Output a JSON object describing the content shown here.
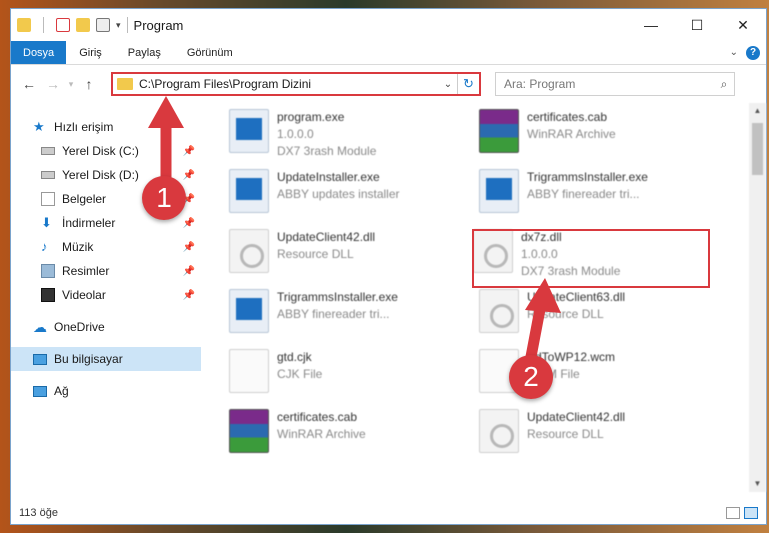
{
  "window": {
    "title": "Program"
  },
  "ribbon": {
    "tabs": [
      "Dosya",
      "Giriş",
      "Paylaş",
      "Görünüm"
    ],
    "help": "?"
  },
  "nav": {
    "back": "←",
    "forward": "→",
    "up": "↑",
    "address": "C:\\Program Files\\Program Dizini",
    "search_placeholder": "Ara: Program"
  },
  "sidebar": {
    "quick_access": "Hızlı erişim",
    "items": [
      {
        "label": "Yerel Disk (C:)"
      },
      {
        "label": "Yerel Disk (D:)"
      },
      {
        "label": "Belgeler"
      },
      {
        "label": "İndirmeler"
      },
      {
        "label": "Müzik"
      },
      {
        "label": "Resimler"
      },
      {
        "label": "Videolar"
      }
    ],
    "onedrive": "OneDrive",
    "this_pc": "Bu bilgisayar",
    "network": "Ağ"
  },
  "files": [
    {
      "name": "program.exe",
      "line1": "1.0.0.0",
      "line2": "DX7 3rash Module"
    },
    {
      "name": "certificates.cab",
      "line1": "WinRAR Archive",
      "line2": ""
    },
    {
      "name": "UpdateInstaller.exe",
      "line1": "ABBY updates installer",
      "line2": ""
    },
    {
      "name": "TrigrammsInstaller.exe",
      "line1": "ABBY finereader tri...",
      "line2": ""
    },
    {
      "name": "UpdateClient42.dll",
      "line1": "Resource DLL",
      "line2": ""
    },
    {
      "name": "dx7z.dll",
      "line1": "1.0.0.0",
      "line2": "DX7 3rash Module"
    },
    {
      "name": "TrigrammsInstaller.exe",
      "line1": "ABBY finereader tri...",
      "line2": ""
    },
    {
      "name": "UpdateClient63.dll",
      "line1": "Resource DLL",
      "line2": ""
    },
    {
      "name": "gtd.cjk",
      "line1": "CJK File",
      "line2": ""
    },
    {
      "name": "AdToWP12.wcm",
      "line1": "WCM File",
      "line2": ""
    },
    {
      "name": "certificates.cab",
      "line1": "WinRAR Archive",
      "line2": ""
    },
    {
      "name": "UpdateClient42.dll",
      "line1": "Resource DLL",
      "line2": ""
    }
  ],
  "status": {
    "count": "113 öğe"
  },
  "callouts": [
    "1",
    "2"
  ],
  "colors": {
    "accent": "#1979ca",
    "highlight": "#d9393e"
  }
}
